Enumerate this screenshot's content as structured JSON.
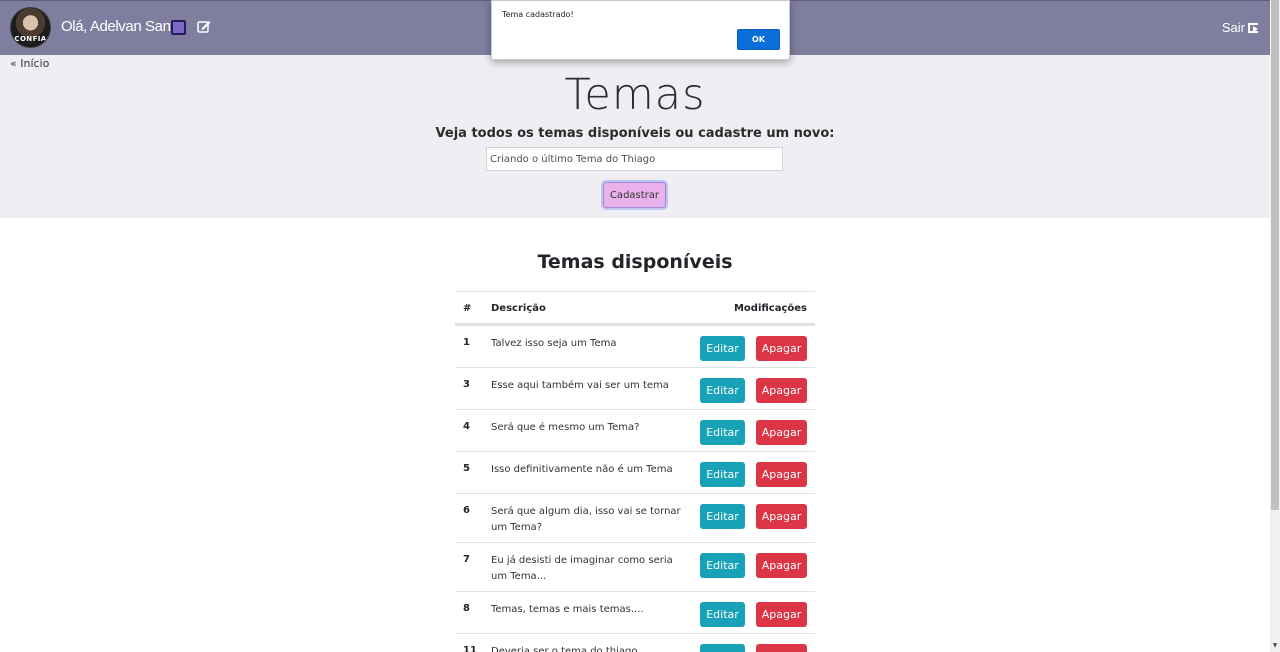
{
  "header": {
    "avatar_label": "CONFIA",
    "greeting": "Olá, Adelvan Santo",
    "logout": "Sair"
  },
  "nav": {
    "back": "« Início"
  },
  "hero": {
    "title": "Temas",
    "subtitle": "Veja todos os temas disponíveis ou cadastre um novo:",
    "input_value": "Criando o último Tema do Thiago",
    "submit_label": "Cadastrar"
  },
  "list": {
    "title": "Temas disponíveis",
    "columns": {
      "id": "#",
      "description": "Descrição",
      "actions": "Modificações"
    },
    "edit_label": "Editar",
    "delete_label": "Apagar",
    "rows": [
      {
        "id": "1",
        "description": "Talvez isso seja um Tema"
      },
      {
        "id": "3",
        "description": "Esse aqui também vai ser um tema"
      },
      {
        "id": "4",
        "description": "Será que é mesmo um Tema?"
      },
      {
        "id": "5",
        "description": "Isso definitivamente não é um Tema"
      },
      {
        "id": "6",
        "description": "Será que algum dia, isso vai se tornar um Tema?"
      },
      {
        "id": "7",
        "description": "Eu já desisti de imaginar como seria um Tema..."
      },
      {
        "id": "8",
        "description": "Temas, temas e mais temas...."
      },
      {
        "id": "11",
        "description": "Deveria ser o tema do thiago"
      }
    ]
  },
  "alert": {
    "message": "Tema cadastrado!",
    "ok_label": "OK"
  }
}
